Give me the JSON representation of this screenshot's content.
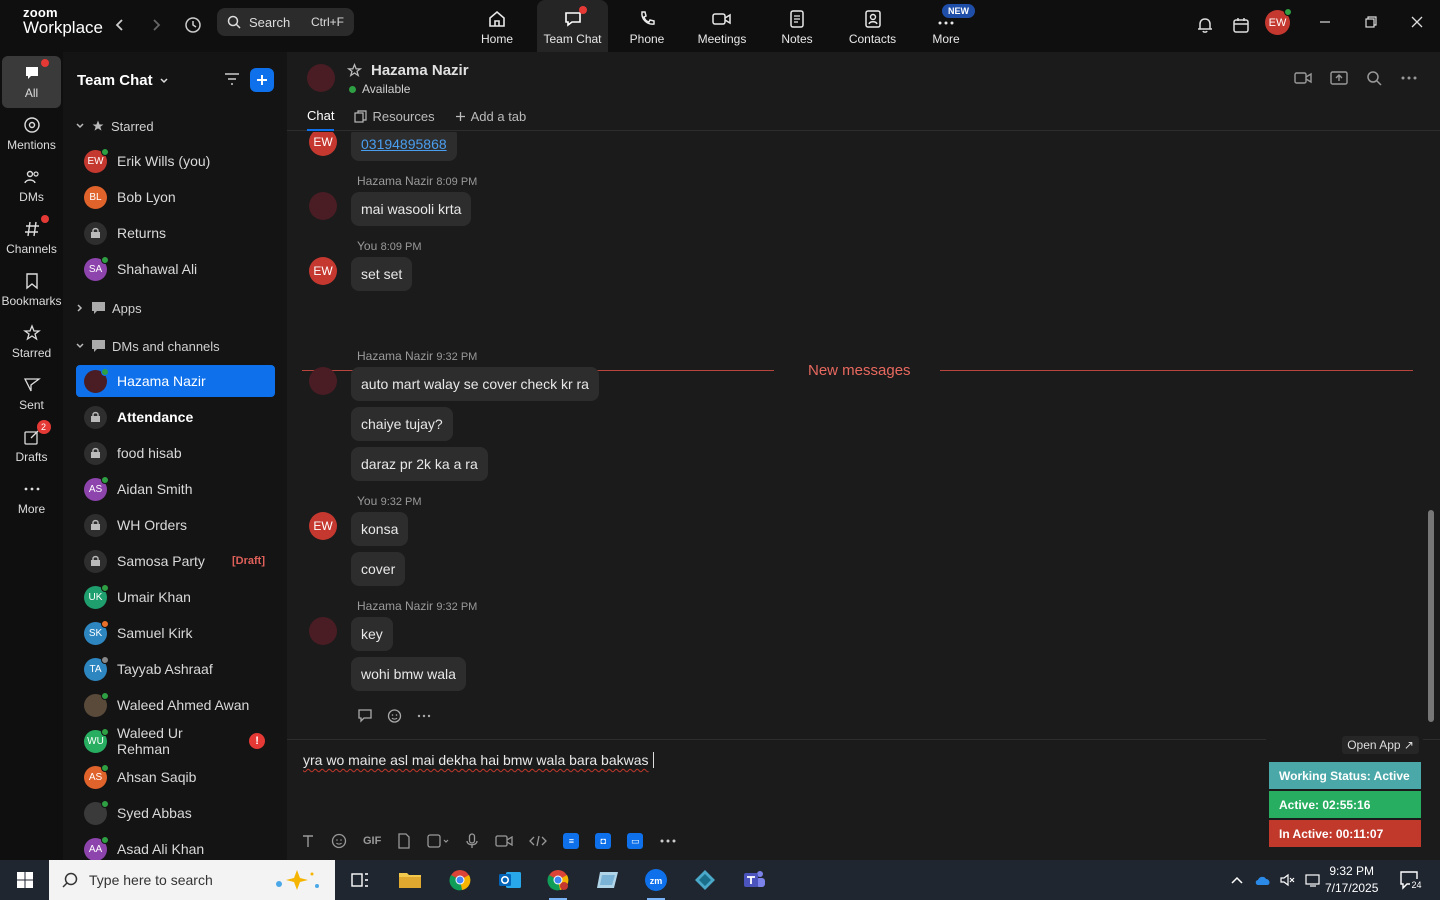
{
  "app": {
    "brand_line1": "zoom",
    "brand_line2": "Workplace"
  },
  "search": {
    "label": "Search",
    "shortcut": "Ctrl+F"
  },
  "top_nav": [
    {
      "label": "Home",
      "icon": "home-icon"
    },
    {
      "label": "Team Chat",
      "icon": "chat-icon",
      "active": true
    },
    {
      "label": "Phone",
      "icon": "phone-icon"
    },
    {
      "label": "Meetings",
      "icon": "video-icon"
    },
    {
      "label": "Notes",
      "icon": "notes-icon"
    },
    {
      "label": "Contacts",
      "icon": "contacts-icon"
    },
    {
      "label": "More",
      "icon": "more-icon",
      "badge": "NEW"
    }
  ],
  "user": {
    "initials": "EW"
  },
  "rail": [
    {
      "label": "All",
      "icon": "chat-bubble-icon",
      "active": true
    },
    {
      "label": "Mentions",
      "icon": "at-icon"
    },
    {
      "label": "DMs",
      "icon": "people-icon"
    },
    {
      "label": "Channels",
      "icon": "hash-icon"
    },
    {
      "label": "Bookmarks",
      "icon": "bookmark-icon"
    },
    {
      "label": "Starred",
      "icon": "star-icon"
    },
    {
      "label": "Sent",
      "icon": "send-icon"
    },
    {
      "label": "Drafts",
      "icon": "draft-icon",
      "badge": "2"
    },
    {
      "label": "More",
      "icon": "ellipsis-icon"
    }
  ],
  "sidebar": {
    "title": "Team Chat",
    "sections": {
      "starred": "Starred",
      "apps": "Apps",
      "dms": "DMs and channels"
    },
    "starred": [
      {
        "name": "Erik Wills (you)",
        "initials": "EW",
        "color": "#c5382f",
        "status": "online"
      },
      {
        "name": "Bob Lyon",
        "initials": "BL",
        "color": "#e0632b",
        "status": "none"
      },
      {
        "name": "Returns",
        "type": "channel"
      },
      {
        "name": "Shahawal Ali",
        "initials": "SA",
        "color": "#8e44ad",
        "status": "online"
      }
    ],
    "dms": [
      {
        "name": "Hazama Nazir",
        "type": "photo",
        "color": "#4a1c24",
        "status": "online",
        "active": true
      },
      {
        "name": "Attendance",
        "type": "channel",
        "bold": true
      },
      {
        "name": "food hisab",
        "type": "channel"
      },
      {
        "name": "Aidan Smith",
        "initials": "AS",
        "color": "#8e44ad",
        "status": "online"
      },
      {
        "name": "WH Orders",
        "type": "channel"
      },
      {
        "name": "Samosa Party",
        "type": "channel",
        "draft": "[Draft]"
      },
      {
        "name": "Umair Khan",
        "initials": "UK",
        "color": "#1f9e6e",
        "status": "online"
      },
      {
        "name": "Samuel Kirk",
        "initials": "SK",
        "color": "#2e86c1",
        "status": "away"
      },
      {
        "name": "Tayyab Ashraaf",
        "initials": "TA",
        "color": "#2e86c1",
        "status": "offline"
      },
      {
        "name": "Waleed Ahmed Awan",
        "type": "photo",
        "color": "#5a4a3a",
        "status": "online"
      },
      {
        "name": "Waleed Ur Rehman",
        "initials": "WU",
        "color": "#27ae60",
        "status": "online",
        "alert": "!"
      },
      {
        "name": "Ahsan Saqib",
        "initials": "AS",
        "color": "#e0632b",
        "status": "online"
      },
      {
        "name": "Syed Abbas",
        "type": "photo",
        "color": "#3a3a3a",
        "status": "online"
      },
      {
        "name": "Asad Ali Khan",
        "initials": "AA",
        "color": "#8e44ad",
        "status": "online"
      }
    ]
  },
  "chat": {
    "name": "Hazama Nazir",
    "status": "Available",
    "tabs": {
      "chat": "Chat",
      "resources": "Resources",
      "add": "Add a tab"
    },
    "new_messages": "New messages",
    "link_bubble": "03194895868",
    "groups": [
      {
        "author": "Hazama Nazir",
        "time": "8:09 PM",
        "who": "her",
        "messages": [
          "mai wasooli krta"
        ]
      },
      {
        "author": "You",
        "time": "8:09 PM",
        "who": "me",
        "messages": [
          "set set"
        ]
      },
      {
        "author": "Hazama Nazir",
        "time": "9:32 PM",
        "who": "her",
        "messages": [
          "auto mart walay se cover check kr ra",
          "chaiye tujay?",
          "daraz pr 2k ka a ra"
        ]
      },
      {
        "author": "You",
        "time": "9:32 PM",
        "who": "me",
        "messages": [
          "konsa",
          "cover"
        ]
      },
      {
        "author": "Hazama Nazir",
        "time": "9:32 PM",
        "who": "her",
        "messages": [
          "key",
          "wohi bmw wala"
        ]
      }
    ],
    "composer_text": "yra wo maine asl mai dekha hai bmw wala bara bakwas"
  },
  "toolbar": {
    "gif": "GIF"
  },
  "widget": {
    "open_app": "Open App ↗",
    "working_status": "Working Status: Active",
    "active": "Active: 02:55:16",
    "inactive": "In Active: 00:11:07",
    "colors": {
      "status": "#4aa8a8",
      "active": "#27ae60",
      "inactive": "#c0392b"
    }
  },
  "taskbar": {
    "search_placeholder": "Type here to search",
    "time": "9:32 PM",
    "date": "7/17/2025",
    "notifications": "24"
  }
}
